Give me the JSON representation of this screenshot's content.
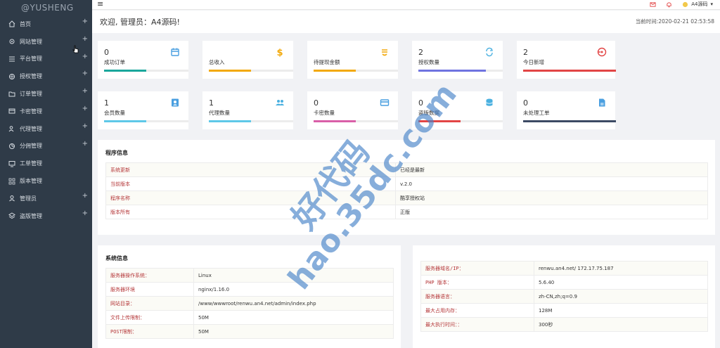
{
  "brand": "@YUSHENG",
  "sidebar": {
    "items": [
      {
        "label": "首页",
        "icon": "home-icon",
        "plus": "+"
      },
      {
        "label": "网站管理",
        "icon": "gear-icon",
        "plus": "+"
      },
      {
        "label": "平台管理",
        "icon": "list-icon",
        "plus": "+"
      },
      {
        "label": "授权管理",
        "icon": "settings-icon",
        "plus": "+"
      },
      {
        "label": "订单管理",
        "icon": "folder-icon",
        "plus": "+"
      },
      {
        "label": "卡密管理",
        "icon": "card-icon",
        "plus": "+"
      },
      {
        "label": "代理管理",
        "icon": "users-icon",
        "plus": "+"
      },
      {
        "label": "分佣管理",
        "icon": "pie-icon",
        "plus": "+"
      },
      {
        "label": "工单管理",
        "icon": "monitor-icon",
        "plus": ""
      },
      {
        "label": "版本管理",
        "icon": "grid-icon",
        "plus": ""
      },
      {
        "label": "管理员",
        "icon": "user-icon",
        "plus": "+"
      },
      {
        "label": "盗版管理",
        "icon": "layers-icon",
        "plus": "+"
      }
    ]
  },
  "topbar": {
    "menu_icon": "≡",
    "username": "A4源码"
  },
  "header": {
    "welcome": "欢迎, 管理员：A4源码!",
    "time_label": "当前时间:2020-02-21 02:53:58"
  },
  "stats": [
    {
      "num": "0",
      "label": "成功订单",
      "color": "#1aa79c",
      "fill": 0.5,
      "icon": "calendar-icon",
      "icon_color": "#4a9fe0"
    },
    {
      "num": "",
      "label": "总收入",
      "color": "#f2a90b",
      "fill": 0.5,
      "icon": "dollar-icon",
      "icon_color": "#f2a90b"
    },
    {
      "num": "",
      "label": "待提现金额",
      "color": "#f2a90b",
      "fill": 0.5,
      "icon": "currency-icon",
      "icon_color": "#f2a90b"
    },
    {
      "num": "2",
      "label": "授权数量",
      "color": "#6f73e0",
      "fill": 0.8,
      "icon": "refresh-icon",
      "icon_color": "#4ab0e0"
    },
    {
      "num": "2",
      "label": "今日新增",
      "color": "#e24545",
      "fill": 1.0,
      "icon": "target-icon",
      "icon_color": "#e24545"
    },
    {
      "num": "1",
      "label": "会员数量",
      "color": "#5ec8e8",
      "fill": 0.5,
      "icon": "contact-icon",
      "icon_color": "#4a9fe0"
    },
    {
      "num": "1",
      "label": "代理数量",
      "color": "#5ec8e8",
      "fill": 0.5,
      "icon": "group-icon",
      "icon_color": "#4ab0e0"
    },
    {
      "num": "0",
      "label": "卡密数量",
      "color": "#d95fa8",
      "fill": 0.5,
      "icon": "creditcard-icon",
      "icon_color": "#4a9fe0"
    },
    {
      "num": "0",
      "label": "盗版数据",
      "color": "#e24545",
      "fill": 0.5,
      "icon": "database-icon",
      "icon_color": "#4ab0e0"
    },
    {
      "num": "0",
      "label": "未处理工单",
      "color": "#3c4a64",
      "fill": 1.0,
      "icon": "file-icon",
      "icon_color": "#4a9fe0"
    }
  ],
  "program": {
    "title": "程序信息",
    "rows": [
      {
        "key": "系统更新",
        "value": "已经是最新"
      },
      {
        "key": "当前版本",
        "value": "v.2.0"
      },
      {
        "key": "程序名称",
        "value": "酷享授权站"
      },
      {
        "key": "版本所有",
        "value": "正版"
      }
    ]
  },
  "system": {
    "title": "系统信息",
    "rows": [
      {
        "key": "服务器操作系统：",
        "value": "Linux"
      },
      {
        "key": "服务器环境",
        "value": "nginx/1.16.0"
      },
      {
        "key": "网站目录：",
        "value": "/www/wwwroot/renwu.an4.net/admin/index.php"
      },
      {
        "key": "文件上传限制：",
        "value": "50M"
      },
      {
        "key": "POST限制：",
        "value": "50M"
      }
    ]
  },
  "server": {
    "rows": [
      {
        "key": "服务器域名/IP：",
        "value": "renwu.an4.net/ 172.17.75.187"
      },
      {
        "key": "PHP 版本：",
        "value": "5.6.40"
      },
      {
        "key": "服务器语言：",
        "value": "zh-CN,zh;q=0.9"
      },
      {
        "key": "最大占用内存：",
        "value": "128M"
      },
      {
        "key": "最大执行时间：：",
        "value": "300秒"
      }
    ]
  },
  "watermark": {
    "cn": "好代码",
    "url": "hao.35dc.com"
  }
}
